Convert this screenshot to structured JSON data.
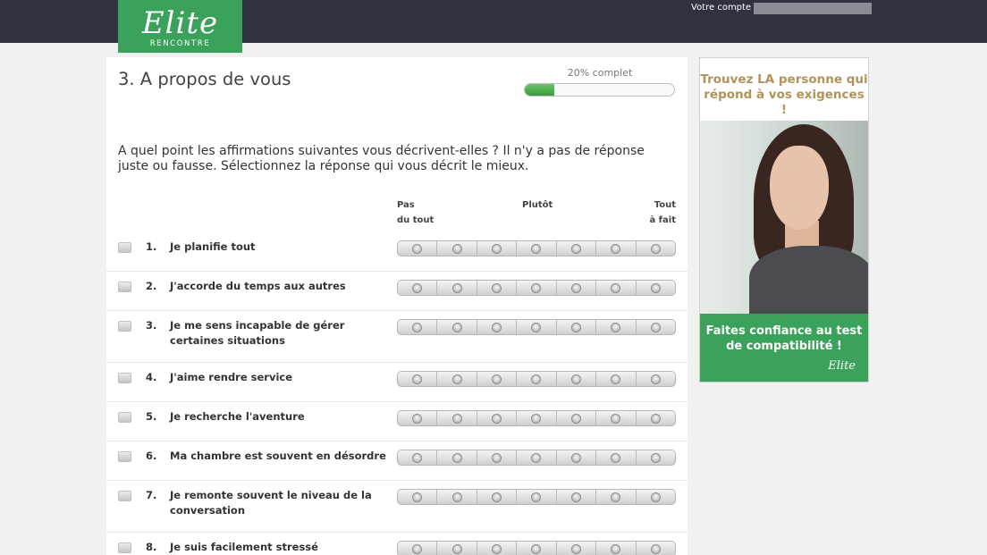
{
  "header": {
    "logo_word": "Elite",
    "logo_sub": "RENCONTRE",
    "account_label": "Votre compte"
  },
  "section": {
    "title": "3. A propos de vous"
  },
  "progress": {
    "label": "20% complet",
    "value": 0.2
  },
  "intro": "A quel point les affirmations suivantes vous décrivent-elles ? Il n'y a pas de réponse juste ou fausse. Sélectionnez la réponse qui vous décrit le mieux.",
  "scale_labels": {
    "left_line1": "Pas",
    "left_line2": "du tout",
    "middle": "Plutôt",
    "right_line1": "Tout",
    "right_line2": "à fait"
  },
  "scale_points": 7,
  "questions": [
    {
      "num": "1.",
      "text": "Je planifie tout"
    },
    {
      "num": "2.",
      "text": "J'accorde du temps aux autres"
    },
    {
      "num": "3.",
      "text": "Je me sens incapable de gérer certaines situations"
    },
    {
      "num": "4.",
      "text": "J'aime rendre service"
    },
    {
      "num": "5.",
      "text": "Je recherche l'aventure"
    },
    {
      "num": "6.",
      "text": "Ma chambre est souvent en désordre"
    },
    {
      "num": "7.",
      "text": "Je remonte souvent le niveau de la conversation"
    },
    {
      "num": "8.",
      "text": "Je suis facilement stressé"
    }
  ],
  "ad": {
    "top_text": "Trouvez LA personne qui répond à vos exigences !",
    "bottom_text": "Faites confiance au test de compatibilité !",
    "logo": "Elite"
  },
  "colors": {
    "brand_green": "#3aa25a",
    "topbar": "#30323f",
    "ad_gold": "#b0935a"
  }
}
